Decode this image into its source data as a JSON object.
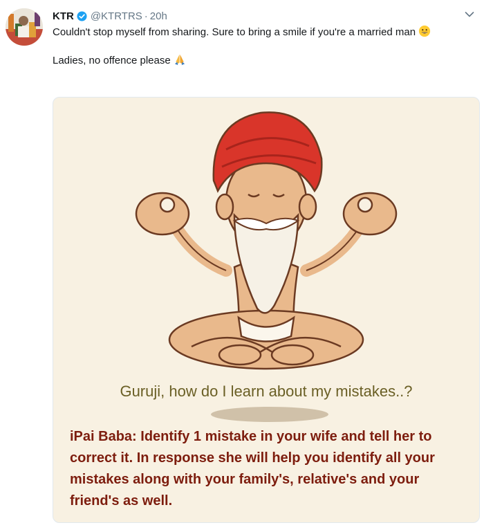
{
  "tweet": {
    "author_name": "KTR",
    "handle": "@KTRTRS",
    "separator": "·",
    "time": "20h",
    "text_line1": "Couldn't stop myself from sharing. Sure to bring a smile if you're a married man",
    "text_line2": "Ladies, no offence please",
    "emoji1": "grinning-face",
    "emoji2": "folded-hands"
  },
  "media": {
    "question": "Guruji, how do I learn about my mistakes..?",
    "answer": "iPai Baba: Identify 1 mistake in your wife and tell her to correct it. In response she will help you identify all your mistakes along with your family's, relative's and your friend's as well."
  },
  "colors": {
    "verified": "#1da1f2",
    "question_text": "#6a5f25",
    "answer_text": "#7d1d0e",
    "turban": "#d9352a",
    "skin": "#e9b98c"
  }
}
